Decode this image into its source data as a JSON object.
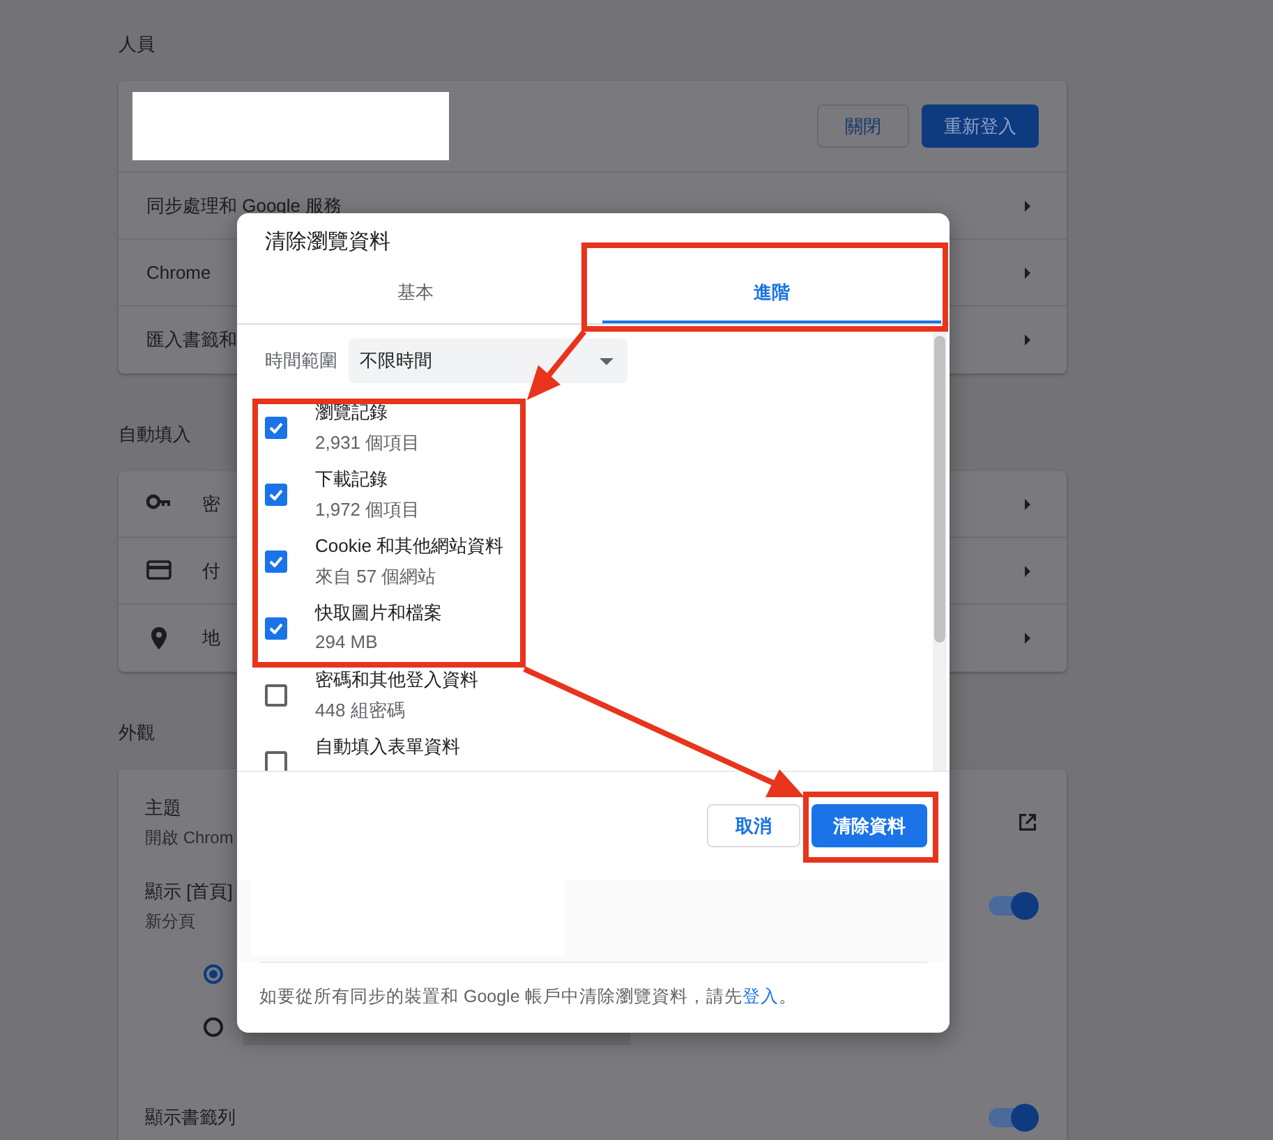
{
  "people": {
    "heading": "人員",
    "close_button": "關閉",
    "sign_in_again_button": "重新登入",
    "rows": [
      {
        "label": "同步處理和 Google 服務"
      },
      {
        "label": "Chrome"
      },
      {
        "label": "匯入書籤和"
      }
    ]
  },
  "autofill": {
    "heading": "自動填入",
    "rows": [
      {
        "kind": "key",
        "label": "密"
      },
      {
        "kind": "card",
        "label": "付"
      },
      {
        "kind": "pin",
        "label": "地"
      }
    ]
  },
  "appearance": {
    "heading": "外觀",
    "items": [
      {
        "kind": "link",
        "title": "主題",
        "subtitle": "開啟 Chrom"
      },
      {
        "kind": "toggle",
        "title": "顯示 [首頁]",
        "subtitle": "新分頁",
        "on": true
      },
      {
        "kind": "radio",
        "selected": true
      },
      {
        "kind": "radio",
        "selected": false
      },
      {
        "kind": "toggle",
        "title": "顯示書籤列",
        "on": true
      }
    ]
  },
  "dialog": {
    "title": "清除瀏覽資料",
    "tabs": [
      {
        "label": "基本",
        "selected": false
      },
      {
        "label": "進階",
        "selected": true
      }
    ],
    "time_range": {
      "label": "時間範圍",
      "value": "不限時間"
    },
    "items": [
      {
        "label": "瀏覽記錄",
        "detail": "2,931 個項目",
        "checked": true
      },
      {
        "label": "下載記錄",
        "detail": "1,972 個項目",
        "checked": true
      },
      {
        "label": "Cookie 和其他網站資料",
        "detail": "來自 57 個網站",
        "checked": true
      },
      {
        "label": "快取圖片和檔案",
        "detail": "294 MB",
        "checked": true
      },
      {
        "label": "密碼和其他登入資料",
        "detail": "448 組密碼",
        "checked": false
      },
      {
        "label": "自動填入表單資料",
        "checked": false
      }
    ],
    "cancel_button": "取消",
    "confirm_button": "清除資料",
    "footer": {
      "text": "如要從所有同步的裝置和 Google 帳戶中清除瀏覽資料，請先",
      "link": "登入",
      "end": "。"
    }
  }
}
